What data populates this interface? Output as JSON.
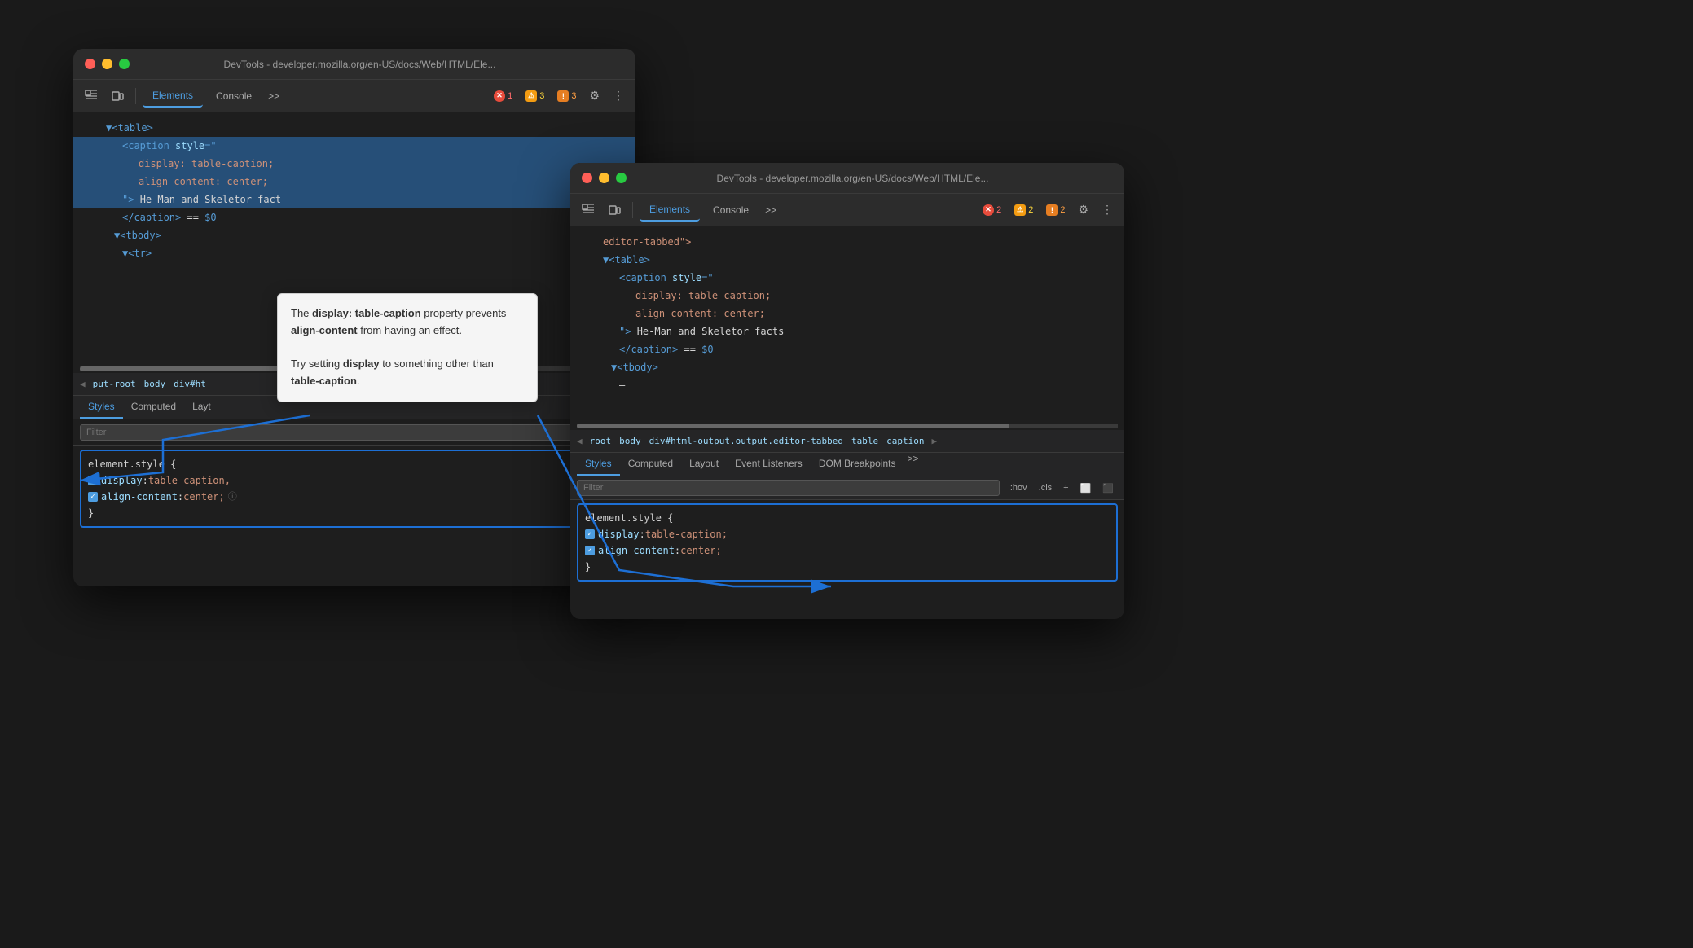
{
  "window1": {
    "title": "DevTools - developer.mozilla.org/en-US/docs/Web/HTML/Ele...",
    "tabs": {
      "elements": "Elements",
      "console": "Console",
      "more": ">>"
    },
    "badges": {
      "error": "1",
      "warning": "3",
      "info": "3"
    },
    "html_tree": [
      {
        "indent": 12,
        "content": "▼<table>",
        "type": "tag",
        "selected": false
      },
      {
        "indent": 20,
        "content": "<caption style=\"",
        "type": "tag",
        "selected": true
      },
      {
        "indent": 28,
        "content": "display: table-caption;",
        "type": "attr-value",
        "selected": true
      },
      {
        "indent": 28,
        "content": "align-content: center;",
        "type": "attr-value",
        "selected": true
      },
      {
        "indent": 20,
        "content": "\"> He-Man and Skeletor fact",
        "type": "text",
        "selected": true
      },
      {
        "indent": 20,
        "content": "</caption> == $0",
        "type": "tag",
        "selected": false
      },
      {
        "indent": 16,
        "content": "▼<tbody>",
        "type": "tag",
        "selected": false
      },
      {
        "indent": 20,
        "content": "▼<tr>",
        "type": "tag",
        "selected": false
      }
    ],
    "breadcrumb": [
      "put-root",
      "body",
      "div#ht"
    ],
    "styles_panel": {
      "tabs": [
        "Styles",
        "Computed",
        "Layt"
      ],
      "filter_placeholder": "Filter",
      "rule": {
        "selector": "element.style {",
        "properties": [
          {
            "prop": "display",
            "value": "table-caption,"
          },
          {
            "prop": "align-content",
            "value": "center;"
          }
        ],
        "close": "}"
      }
    }
  },
  "window2": {
    "title": "DevTools - developer.mozilla.org/en-US/docs/Web/HTML/Ele...",
    "tabs": {
      "elements": "Elements",
      "console": "Console",
      "more": ">>"
    },
    "badges": {
      "error": "2",
      "warning": "2",
      "info": "2"
    },
    "html_tree": [
      {
        "indent": 12,
        "content": "editor-tabbed\">",
        "type": "text"
      },
      {
        "indent": 12,
        "content": "▼<table>",
        "type": "tag"
      },
      {
        "indent": 20,
        "content": "<caption style=\"",
        "type": "tag"
      },
      {
        "indent": 28,
        "content": "display: table-caption;",
        "type": "attr-value"
      },
      {
        "indent": 28,
        "content": "align-content: center;",
        "type": "attr-value"
      },
      {
        "indent": 20,
        "content": "\"> He-Man and Skeletor facts",
        "type": "text"
      },
      {
        "indent": 20,
        "content": "</caption> == $0",
        "type": "tag"
      },
      {
        "indent": 16,
        "content": "▼<tbody>",
        "type": "tag"
      },
      {
        "indent": 20,
        "content": "—",
        "type": "text"
      }
    ],
    "breadcrumb": [
      "root",
      "body",
      "div#html-output.output.editor-tabbed",
      "table",
      "caption"
    ],
    "styles_panel": {
      "tabs": [
        "Styles",
        "Computed",
        "Layout",
        "Event Listeners",
        "DOM Breakpoints",
        ">>"
      ],
      "filter_placeholder": "Filter",
      "panel_tools": [
        ":hov",
        ".cls",
        "+",
        "⬜",
        "⬛"
      ],
      "rule": {
        "selector": "element.style {",
        "properties": [
          {
            "prop": "display",
            "value": "table-caption;"
          },
          {
            "prop": "align-content",
            "value": "center;"
          }
        ],
        "close": "}"
      }
    }
  },
  "tooltip": {
    "text_parts": [
      "The ",
      "display: table-caption",
      " property prevents ",
      "align-content",
      " from having an effect.",
      "\n\nTry setting ",
      "display",
      " to something other than ",
      "table-caption",
      "."
    ],
    "line1": "The display: table-caption property prevents align-content from having an effect.",
    "line2": "Try setting display to something other than table-caption."
  },
  "icons": {
    "inspect": "⬚",
    "device": "⬜",
    "gear": "⚙",
    "more": "⋮",
    "back": "◀"
  }
}
